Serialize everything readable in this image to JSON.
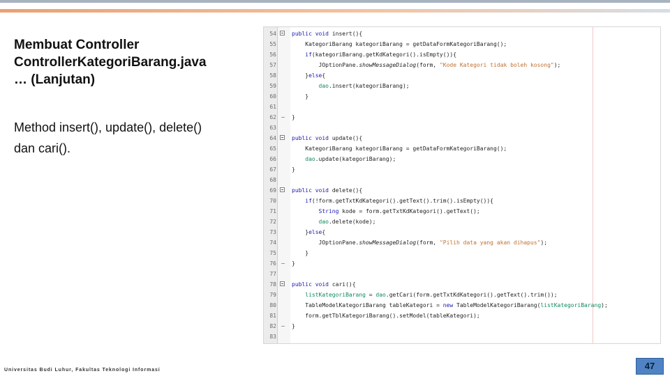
{
  "slide": {
    "title_lines": [
      "Membuat Controller",
      "ControllerKategoriBarang.java",
      "… (Lanjutan)"
    ],
    "description_lines": [
      "Method insert(), update(), delete()",
      "dan cari()."
    ],
    "footer": "Universitas Budi Luhur, Fakultas Teknologi Informasi",
    "page_number": "47"
  },
  "editor": {
    "lines": [
      {
        "num": "54",
        "code": "public void insert(){"
      },
      {
        "num": "55",
        "code": "    KategoriBarang kategoriBarang = getDataFormKategoriBarang();"
      },
      {
        "num": "56",
        "code": "    if(kategoriBarang.getKdKategori().isEmpty()){"
      },
      {
        "num": "57",
        "code": "        JOptionPane.showMessageDialog(form, \"Kode Kategori tidak boleh kosong\");"
      },
      {
        "num": "58",
        "code": "    }else{"
      },
      {
        "num": "59",
        "code": "        dao.insert(kategoriBarang);"
      },
      {
        "num": "60",
        "code": "    }"
      },
      {
        "num": "61",
        "code": ""
      },
      {
        "num": "62",
        "code": "}"
      },
      {
        "num": "63",
        "code": ""
      },
      {
        "num": "64",
        "code": "public void update(){"
      },
      {
        "num": "65",
        "code": "    KategoriBarang kategoriBarang = getDataFormKategoriBarang();"
      },
      {
        "num": "66",
        "code": "    dao.update(kategoriBarang);"
      },
      {
        "num": "67",
        "code": "}"
      },
      {
        "num": "68",
        "code": ""
      },
      {
        "num": "69",
        "code": "public void delete(){"
      },
      {
        "num": "70",
        "code": "    if(!form.getTxtKdKategori().getText().trim().isEmpty()){"
      },
      {
        "num": "71",
        "code": "        String kode = form.getTxtKdKategori().getText();"
      },
      {
        "num": "72",
        "code": "        dao.delete(kode);"
      },
      {
        "num": "73",
        "code": "    }else{"
      },
      {
        "num": "74",
        "code": "        JOptionPane.showMessageDialog(form, \"Pilih data yang akan dihapus\");"
      },
      {
        "num": "75",
        "code": "    }"
      },
      {
        "num": "76",
        "code": "}"
      },
      {
        "num": "77",
        "code": ""
      },
      {
        "num": "78",
        "code": "public void cari(){"
      },
      {
        "num": "79",
        "code": "    listKategoriBarang = dao.getCari(form.getTxtKdKategori().getText().trim());"
      },
      {
        "num": "80",
        "code": "    TableModelKategoriBarang tableKategori = new TableModelKategoriBarang(listKategoriBarang);"
      },
      {
        "num": "81",
        "code": "    form.getTblKategoriBarang().setModel(tableKategori);"
      },
      {
        "num": "82",
        "code": "}"
      },
      {
        "num": "83",
        "code": ""
      }
    ]
  },
  "colors": {
    "accent": "#e9a172",
    "keyword": "#1a1ab0",
    "string": "#c07030",
    "field": "#0e8a5f",
    "page_badge": "#4f83c4"
  }
}
